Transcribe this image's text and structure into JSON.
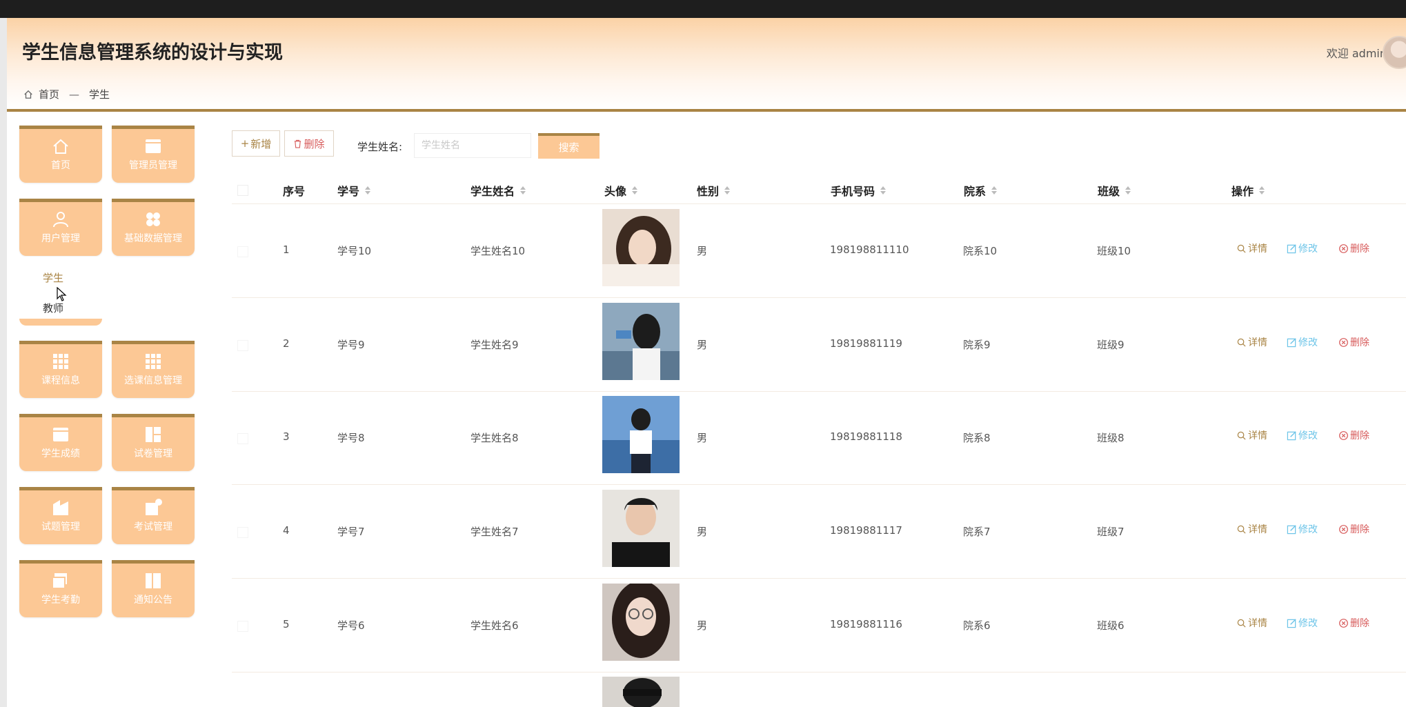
{
  "app": {
    "title": "学生信息管理系统的设计与实现",
    "welcome": "欢迎 admin",
    "accent": "#a98445",
    "tile_color": "#fcc895"
  },
  "breadcrumb": {
    "home": "首页",
    "separator": "—",
    "current": "学生"
  },
  "sidebar": {
    "tiles": [
      {
        "label": "首页",
        "icon": "home-icon"
      },
      {
        "label": "管理员管理",
        "icon": "card-icon"
      },
      {
        "label": "用户管理",
        "icon": "user-icon"
      },
      {
        "label": "基础数据管理",
        "icon": "clover-icon"
      },
      {
        "label": "课程信息",
        "icon": "grid-icon"
      },
      {
        "label": "选课信息管理",
        "icon": "grid-icon"
      },
      {
        "label": "学生成绩",
        "icon": "card-icon"
      },
      {
        "label": "试卷管理",
        "icon": "layout-icon"
      },
      {
        "label": "试题管理",
        "icon": "doc-icon"
      },
      {
        "label": "考试管理",
        "icon": "badge-icon"
      },
      {
        "label": "学生考勤",
        "icon": "copy-icon"
      },
      {
        "label": "通知公告",
        "icon": "book-icon"
      }
    ],
    "submenu": [
      "学生",
      "教师"
    ]
  },
  "toolbar": {
    "add_label": "新增",
    "delete_label": "删除",
    "search_label": "学生姓名:",
    "search_placeholder": "学生姓名",
    "search_button": "搜索"
  },
  "table": {
    "headers": [
      "序号",
      "学号",
      "学生姓名",
      "头像",
      "性别",
      "手机号码",
      "院系",
      "班级",
      "操作"
    ],
    "actions": {
      "detail": "详情",
      "edit": "修改",
      "remove": "删除"
    },
    "rows": [
      {
        "index": "1",
        "student_no": "学号10",
        "name": "学生姓名10",
        "gender": "男",
        "phone": "198198811110",
        "department": "院系10",
        "class": "班级10"
      },
      {
        "index": "2",
        "student_no": "学号9",
        "name": "学生姓名9",
        "gender": "男",
        "phone": "19819881119",
        "department": "院系9",
        "class": "班级9"
      },
      {
        "index": "3",
        "student_no": "学号8",
        "name": "学生姓名8",
        "gender": "男",
        "phone": "19819881118",
        "department": "院系8",
        "class": "班级8"
      },
      {
        "index": "4",
        "student_no": "学号7",
        "name": "学生姓名7",
        "gender": "男",
        "phone": "19819881117",
        "department": "院系7",
        "class": "班级7"
      },
      {
        "index": "5",
        "student_no": "学号6",
        "name": "学生姓名6",
        "gender": "男",
        "phone": "19819881116",
        "department": "院系6",
        "class": "班级6"
      }
    ]
  }
}
